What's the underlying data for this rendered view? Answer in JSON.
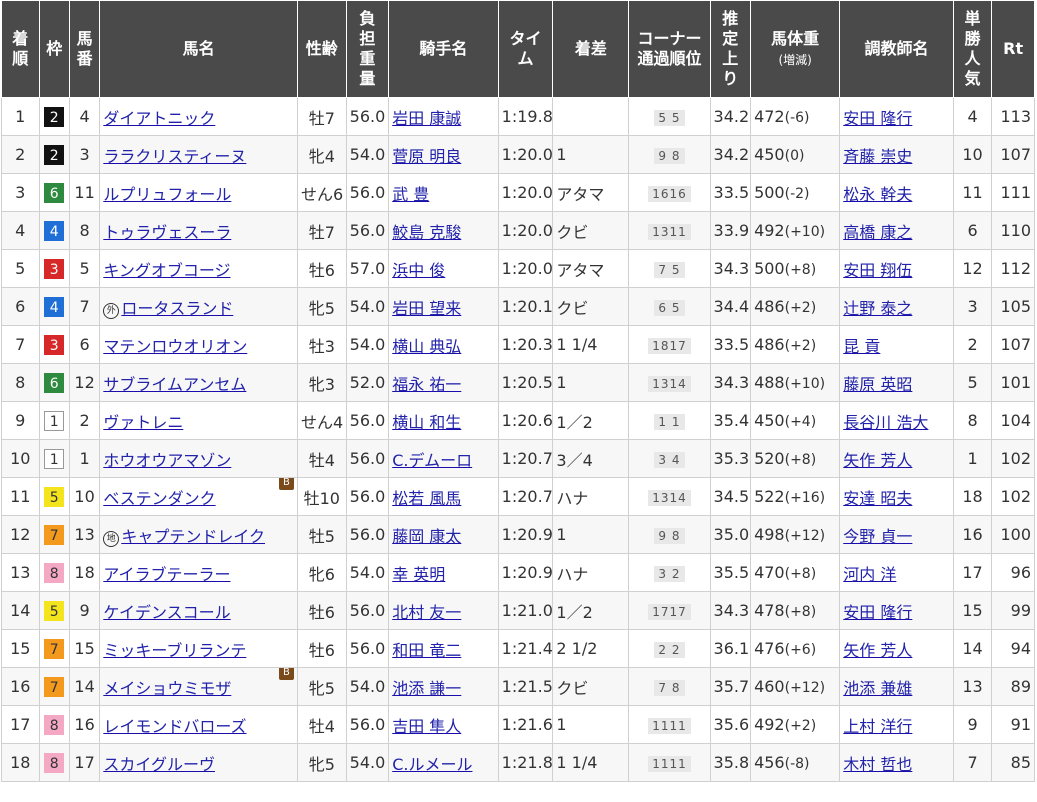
{
  "headers": {
    "rank": [
      "着",
      "順"
    ],
    "waku": "枠",
    "umaban": [
      "馬",
      "番"
    ],
    "horse": "馬名",
    "sexage": "性齢",
    "weight": [
      "負",
      "担",
      "重",
      "量"
    ],
    "jockey": "騎手名",
    "time": [
      "タイ",
      "ム"
    ],
    "margin": "着差",
    "corner": [
      "コーナー",
      "通過順位"
    ],
    "last3f": [
      "推",
      "定",
      "上",
      "り"
    ],
    "bodyweight": [
      "馬体重",
      "(増減)"
    ],
    "trainer": "調教師名",
    "pop": [
      "単",
      "勝",
      "人",
      "気"
    ],
    "rating": "Rt"
  },
  "rows": [
    {
      "rank": "1",
      "waku": "2",
      "umaban": "4",
      "mark": "",
      "horse": "ダイアトニック",
      "blinker": "",
      "sexage": "牡7",
      "weight": "56.0",
      "jockey": "岩田 康誠",
      "time": "1:19.8",
      "margin": "",
      "corner": "5 5",
      "last3f": "34.2",
      "bw": "472",
      "bwd": "(-6)",
      "trainer": "安田 隆行",
      "pop": "4",
      "rating": "113"
    },
    {
      "rank": "2",
      "waku": "2",
      "umaban": "3",
      "mark": "",
      "horse": "ララクリスティーヌ",
      "blinker": "",
      "sexage": "牝4",
      "weight": "54.0",
      "jockey": "菅原 明良",
      "time": "1:20.0",
      "margin": "1",
      "corner": "9 8",
      "last3f": "34.2",
      "bw": "450",
      "bwd": "(0)",
      "trainer": "斉藤 崇史",
      "pop": "10",
      "rating": "107"
    },
    {
      "rank": "3",
      "waku": "6",
      "umaban": "11",
      "mark": "",
      "horse": "ルプリュフォール",
      "blinker": "",
      "sexage": "せん6",
      "weight": "56.0",
      "jockey": "武 豊",
      "time": "1:20.0",
      "margin": "アタマ",
      "corner": "1616",
      "last3f": "33.5",
      "bw": "500",
      "bwd": "(-2)",
      "trainer": "松永 幹夫",
      "pop": "11",
      "rating": "111"
    },
    {
      "rank": "4",
      "waku": "4",
      "umaban": "8",
      "mark": "",
      "horse": "トゥラヴェスーラ",
      "blinker": "",
      "sexage": "牡7",
      "weight": "56.0",
      "jockey": "鮫島 克駿",
      "time": "1:20.0",
      "margin": "クビ",
      "corner": "1311",
      "last3f": "33.9",
      "bw": "492",
      "bwd": "(+10)",
      "trainer": "高橋 康之",
      "pop": "6",
      "rating": "110"
    },
    {
      "rank": "5",
      "waku": "3",
      "umaban": "5",
      "mark": "",
      "horse": "キングオブコージ",
      "blinker": "",
      "sexage": "牡6",
      "weight": "57.0",
      "jockey": "浜中 俊",
      "time": "1:20.0",
      "margin": "アタマ",
      "corner": "7 5",
      "last3f": "34.3",
      "bw": "500",
      "bwd": "(+8)",
      "trainer": "安田 翔伍",
      "pop": "12",
      "rating": "112"
    },
    {
      "rank": "6",
      "waku": "4",
      "umaban": "7",
      "mark": "外",
      "horse": "ロータスランド",
      "blinker": "",
      "sexage": "牝5",
      "weight": "54.0",
      "jockey": "岩田 望来",
      "time": "1:20.1",
      "margin": "クビ",
      "corner": "6 5",
      "last3f": "34.4",
      "bw": "486",
      "bwd": "(+2)",
      "trainer": "辻野 泰之",
      "pop": "3",
      "rating": "105"
    },
    {
      "rank": "7",
      "waku": "3",
      "umaban": "6",
      "mark": "",
      "horse": "マテンロウオリオン",
      "blinker": "",
      "sexage": "牡3",
      "weight": "54.0",
      "jockey": "横山 典弘",
      "time": "1:20.3",
      "margin": "1 1/4",
      "corner": "1817",
      "last3f": "33.5",
      "bw": "486",
      "bwd": "(+2)",
      "trainer": "昆 貢",
      "pop": "2",
      "rating": "107"
    },
    {
      "rank": "8",
      "waku": "6",
      "umaban": "12",
      "mark": "",
      "horse": "サブライムアンセム",
      "blinker": "",
      "sexage": "牝3",
      "weight": "52.0",
      "jockey": "福永 祐一",
      "time": "1:20.5",
      "margin": "1",
      "corner": "1314",
      "last3f": "34.3",
      "bw": "488",
      "bwd": "(+10)",
      "trainer": "藤原 英昭",
      "pop": "5",
      "rating": "101"
    },
    {
      "rank": "9",
      "waku": "1",
      "umaban": "2",
      "mark": "",
      "horse": "ヴァトレニ",
      "blinker": "",
      "sexage": "せん4",
      "weight": "56.0",
      "jockey": "横山 和生",
      "time": "1:20.6",
      "margin": "1／2",
      "corner": "1 1",
      "last3f": "35.4",
      "bw": "450",
      "bwd": "(+4)",
      "trainer": "長谷川 浩大",
      "pop": "8",
      "rating": "104"
    },
    {
      "rank": "10",
      "waku": "1",
      "umaban": "1",
      "mark": "",
      "horse": "ホウオウアマゾン",
      "blinker": "",
      "sexage": "牡4",
      "weight": "56.0",
      "jockey": "C.デムーロ",
      "time": "1:20.7",
      "margin": "3／4",
      "corner": "3 4",
      "last3f": "35.3",
      "bw": "520",
      "bwd": "(+8)",
      "trainer": "矢作 芳人",
      "pop": "1",
      "rating": "102"
    },
    {
      "rank": "11",
      "waku": "5",
      "umaban": "10",
      "mark": "",
      "horse": "ベステンダンク",
      "blinker": "B",
      "sexage": "牡10",
      "weight": "56.0",
      "jockey": "松若 風馬",
      "time": "1:20.7",
      "margin": "ハナ",
      "corner": "1314",
      "last3f": "34.5",
      "bw": "522",
      "bwd": "(+16)",
      "trainer": "安達 昭夫",
      "pop": "18",
      "rating": "102"
    },
    {
      "rank": "12",
      "waku": "7",
      "umaban": "13",
      "mark": "地",
      "horse": "キャプテンドレイク",
      "blinker": "",
      "sexage": "牡5",
      "weight": "56.0",
      "jockey": "藤岡 康太",
      "time": "1:20.9",
      "margin": "1",
      "corner": "9 8",
      "last3f": "35.0",
      "bw": "498",
      "bwd": "(+12)",
      "trainer": "今野 貞一",
      "pop": "16",
      "rating": "100"
    },
    {
      "rank": "13",
      "waku": "8",
      "umaban": "18",
      "mark": "",
      "horse": "アイラブテーラー",
      "blinker": "",
      "sexage": "牝6",
      "weight": "54.0",
      "jockey": "幸 英明",
      "time": "1:20.9",
      "margin": "ハナ",
      "corner": "3 2",
      "last3f": "35.5",
      "bw": "470",
      "bwd": "(+8)",
      "trainer": "河内 洋",
      "pop": "17",
      "rating": "96"
    },
    {
      "rank": "14",
      "waku": "5",
      "umaban": "9",
      "mark": "",
      "horse": "ケイデンスコール",
      "blinker": "",
      "sexage": "牡6",
      "weight": "56.0",
      "jockey": "北村 友一",
      "time": "1:21.0",
      "margin": "1／2",
      "corner": "1717",
      "last3f": "34.3",
      "bw": "478",
      "bwd": "(+8)",
      "trainer": "安田 隆行",
      "pop": "15",
      "rating": "99"
    },
    {
      "rank": "15",
      "waku": "7",
      "umaban": "15",
      "mark": "",
      "horse": "ミッキーブリランテ",
      "blinker": "",
      "sexage": "牡6",
      "weight": "56.0",
      "jockey": "和田 竜二",
      "time": "1:21.4",
      "margin": "2 1/2",
      "corner": "2 2",
      "last3f": "36.1",
      "bw": "476",
      "bwd": "(+6)",
      "trainer": "矢作 芳人",
      "pop": "14",
      "rating": "94"
    },
    {
      "rank": "16",
      "waku": "7",
      "umaban": "14",
      "mark": "",
      "horse": "メイショウミモザ",
      "blinker": "B",
      "sexage": "牝5",
      "weight": "54.0",
      "jockey": "池添 謙一",
      "time": "1:21.5",
      "margin": "クビ",
      "corner": "7 8",
      "last3f": "35.7",
      "bw": "460",
      "bwd": "(+12)",
      "trainer": "池添 兼雄",
      "pop": "13",
      "rating": "89"
    },
    {
      "rank": "17",
      "waku": "8",
      "umaban": "16",
      "mark": "",
      "horse": "レイモンドバローズ",
      "blinker": "",
      "sexage": "牡4",
      "weight": "56.0",
      "jockey": "吉田 隼人",
      "time": "1:21.6",
      "margin": "1",
      "corner": "1111",
      "last3f": "35.6",
      "bw": "492",
      "bwd": "(+2)",
      "trainer": "上村 洋行",
      "pop": "9",
      "rating": "91"
    },
    {
      "rank": "18",
      "waku": "8",
      "umaban": "17",
      "mark": "",
      "horse": "スカイグルーヴ",
      "blinker": "",
      "sexage": "牝5",
      "weight": "54.0",
      "jockey": "C.ルメール",
      "time": "1:21.8",
      "margin": "1 1/4",
      "corner": "1111",
      "last3f": "35.8",
      "bw": "456",
      "bwd": "(-8)",
      "trainer": "木村 哲也",
      "pop": "7",
      "rating": "85"
    }
  ],
  "colors": {
    "header_bg": "#4a4a4a",
    "link": "#2222aa",
    "waku1": "#ffffff",
    "waku2": "#111111",
    "waku3": "#d62828",
    "waku4": "#1f6fd6",
    "waku5": "#f4e41e",
    "waku6": "#2e8a3e",
    "waku7": "#f39a1e",
    "waku8": "#f4a8c4"
  }
}
